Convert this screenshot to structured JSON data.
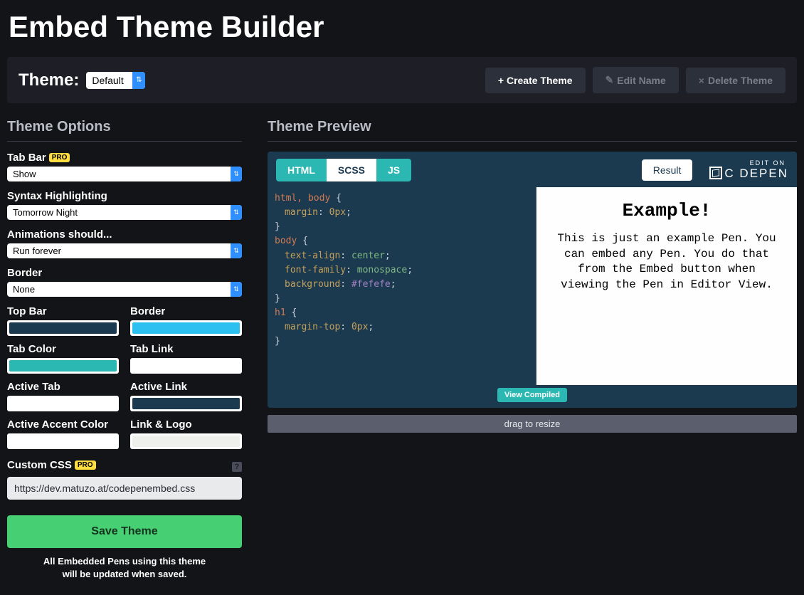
{
  "title": "Embed Theme Builder",
  "themeBar": {
    "label": "Theme:",
    "selected": "Default",
    "createLabel": "+ Create Theme",
    "editLabel": "Edit Name",
    "deleteLabel": "Delete Theme"
  },
  "options": {
    "heading": "Theme Options",
    "tabBarLabel": "Tab Bar",
    "proBadge": "PRO",
    "tabBarValue": "Show",
    "syntaxLabel": "Syntax Highlighting",
    "syntaxValue": "Tomorrow Night",
    "animLabel": "Animations should...",
    "animValue": "Run forever",
    "borderLabel": "Border",
    "borderValue": "None",
    "colors": {
      "topBar": {
        "label": "Top Bar",
        "value": "#1b3a50"
      },
      "border": {
        "label": "Border",
        "value": "#2cc0f0"
      },
      "tabColor": {
        "label": "Tab Color",
        "value": "#2bb8b3"
      },
      "tabLink": {
        "label": "Tab Link",
        "value": "#ffffff"
      },
      "activeTab": {
        "label": "Active Tab",
        "value": "#ffffff"
      },
      "activeLink": {
        "label": "Active Link",
        "value": "#1b3a50"
      },
      "activeAccent": {
        "label": "Active Accent Color",
        "value": "#ffffff"
      },
      "linkLogo": {
        "label": "Link & Logo",
        "value": "#eef0eb"
      }
    },
    "customCssLabel": "Custom CSS",
    "customCssValue": "https://dev.matuzo.at/codepenembed.css",
    "saveLabel": "Save Theme",
    "saveNote": "All Embedded Pens using this theme will be updated when saved."
  },
  "preview": {
    "heading": "Theme Preview",
    "tabs": {
      "html": "HTML",
      "scss": "SCSS",
      "js": "JS"
    },
    "resultLabel": "Result",
    "editOn": "EDIT ON",
    "brand": "C  DEPEN",
    "viewCompiled": "View Compiled",
    "resize": "drag to resize",
    "code": {
      "l1_sel": "html, body",
      "l2_prop": "margin",
      "l2_val": "0px",
      "l3_sel": "body",
      "l4_prop": "text-align",
      "l4_val": "center",
      "l5_prop": "font-family",
      "l5_val": "monospace",
      "l6_prop": "background",
      "l6_val": "#fefefe",
      "l7_sel": "h1",
      "l8_prop": "margin-top",
      "l8_val": "0px"
    },
    "result": {
      "heading": "Example!",
      "body": "This is just an example Pen. You can embed any Pen. You do that from the Embed button when viewing the Pen in Editor View."
    }
  }
}
